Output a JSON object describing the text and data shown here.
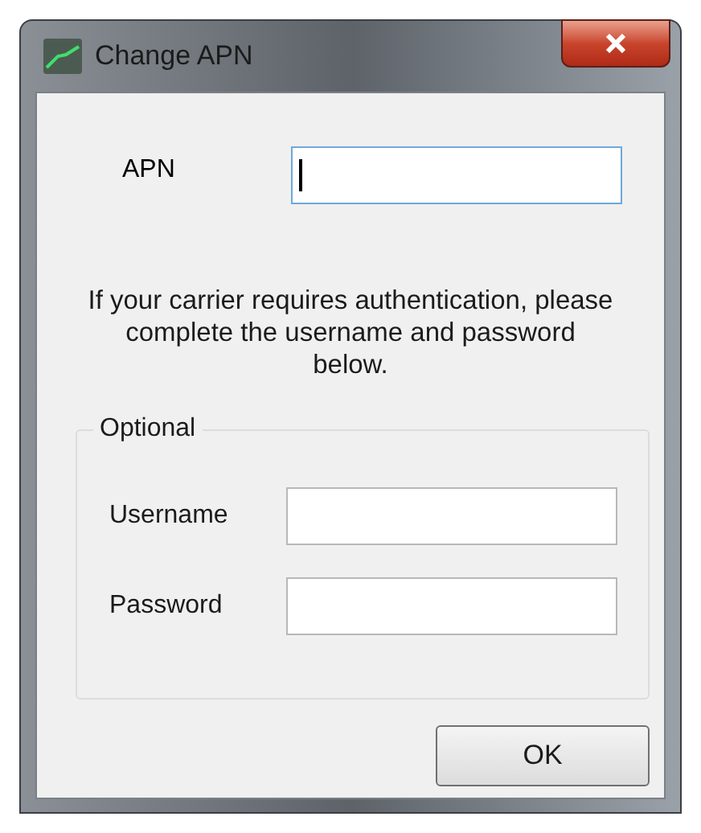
{
  "window": {
    "title": "Change APN"
  },
  "apn": {
    "label": "APN",
    "focused": true
  },
  "message": "If your carrier requires authentication, please complete the username and password below.",
  "optional_group": {
    "title": "Optional",
    "fields": [
      {
        "label": "Username",
        "focused": false
      },
      {
        "label": "Password",
        "focused": false
      }
    ]
  },
  "buttons": [
    "OK"
  ]
}
